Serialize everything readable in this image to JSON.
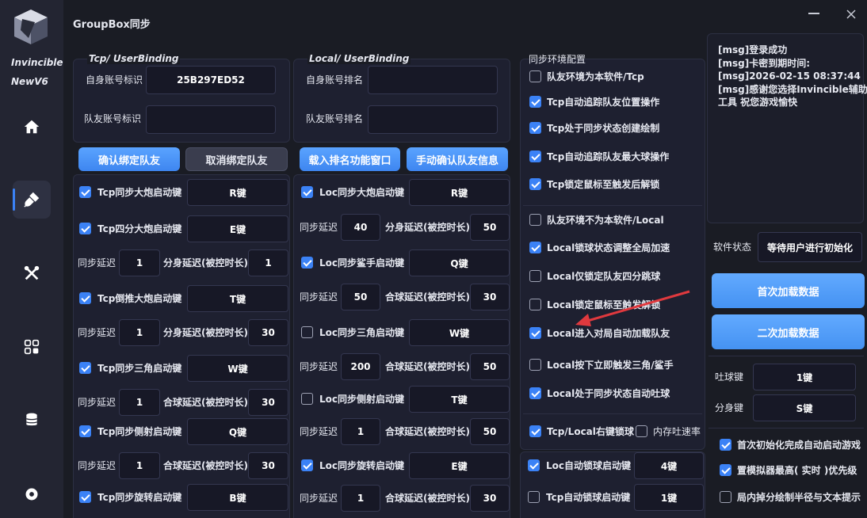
{
  "app": {
    "logo_line1": "Invincible",
    "logo_line2": "NewV6",
    "title": "GroupBox同步"
  },
  "colors": {
    "accent": "#3b82f6",
    "bg": "#1a1c24",
    "sidebar": "#232532",
    "panel": "#1e2030",
    "field": "#171826"
  },
  "sidebar": {
    "icons": [
      "home-icon",
      "plug-icon",
      "tools-icon",
      "apps-icon",
      "database-icon",
      "settings-icon"
    ],
    "active": "plug-icon"
  },
  "tcp": {
    "group_title": "Tcp/ UserBinding",
    "self_label": "自身账号标识",
    "self_value": "25B297ED52",
    "mate_label": "队友账号标识",
    "mate_value": "",
    "bind_btn": "确认绑定队友",
    "unbind_btn": "取消绑定队友",
    "keys": [
      {
        "label": "Tcp同步大炮启动键",
        "checked": true,
        "key": "R键"
      },
      {
        "label": "Tcp四分大炮启动键",
        "checked": true,
        "key": "E键"
      },
      {
        "label": "Tcp倒推大炮启动键",
        "checked": true,
        "key": "T键"
      },
      {
        "label": "Tcp同步三角启动键",
        "checked": true,
        "key": "W键"
      },
      {
        "label": "Tcp同步侧射启动键",
        "checked": true,
        "key": "Q键"
      },
      {
        "label": "Tcp同步旋转启动键",
        "checked": true,
        "key": "B键"
      }
    ],
    "delays": [
      {
        "l1": "同步延迟",
        "v1": "1",
        "l2": "分身延迟(被控时长)",
        "v2": "1"
      },
      {
        "l1": "同步延迟",
        "v1": "1",
        "l2": "分身延迟(被控时长)",
        "v2": "30"
      },
      {
        "l1": "同步延迟",
        "v1": "1",
        "l2": "合球延迟(被控时长)",
        "v2": "30"
      },
      {
        "l1": "同步延迟",
        "v1": "1",
        "l2": "合球延迟(被控时长)",
        "v2": "30"
      }
    ]
  },
  "local": {
    "group_title": "Local/ UserBinding",
    "self_label": "自身账号排名",
    "self_value": "",
    "mate_label": "队友账号排名",
    "mate_value": "",
    "load_btn": "载入排名功能窗口",
    "confirm_btn": "手动确认队友信息",
    "keys": [
      {
        "label": "Loc同步大炮启动键",
        "checked": true,
        "key": "R键"
      },
      {
        "label": "Loc同步鲨手启动键",
        "checked": true,
        "key": "Q键"
      },
      {
        "label": "Loc同步三角启动键",
        "checked": false,
        "key": "W键"
      },
      {
        "label": "Loc同步侧射启动键",
        "checked": false,
        "key": "T键"
      },
      {
        "label": "Loc同步旋转启动键",
        "checked": true,
        "key": "E键"
      }
    ],
    "delays": [
      {
        "l1": "同步延迟",
        "v1": "40",
        "l2": "分身延迟(被控时长)",
        "v2": "50"
      },
      {
        "l1": "同步延迟",
        "v1": "50",
        "l2": "合球延迟(被控时长)",
        "v2": "30"
      },
      {
        "l1": "同步延迟",
        "v1": "200",
        "l2": "合球延迟(被控时长)",
        "v2": "50"
      },
      {
        "l1": "同步延迟",
        "v1": "1",
        "l2": "合球延迟(被控时长)",
        "v2": "50"
      },
      {
        "l1": "同步延迟",
        "v1": "1",
        "l2": "合球延迟(被控时长)",
        "v2": "30"
      }
    ]
  },
  "sync": {
    "title": "同步环境配置",
    "options": [
      {
        "label": "队友环境为本软件/Tcp",
        "checked": false
      },
      {
        "label": "Tcp自动追踪队友位置操作",
        "checked": true
      },
      {
        "label": "Tcp处于同步状态创建绘制",
        "checked": true
      },
      {
        "label": "Tcp自动追踪队友最大球操作",
        "checked": true
      },
      {
        "label": "Tcp锁定鼠标至触发后解锁",
        "checked": true
      },
      {
        "label": "队友环境不为本软件/Local",
        "checked": false
      },
      {
        "label": "Local锁球状态调整全局加速",
        "checked": true
      },
      {
        "label": "Local仅锁定队友四分跳球",
        "checked": false
      },
      {
        "label": "Local锁定鼠标至触发解锁",
        "checked": false
      },
      {
        "label": "Local进入对局自动加载队友",
        "checked": true
      },
      {
        "label": "Local按下立即触发三角/鲨手",
        "checked": false
      },
      {
        "label": "Local处于同步状态自动吐球",
        "checked": true
      }
    ],
    "rightlock": {
      "label": "Tcp/Local右键锁球",
      "checked": true
    },
    "memspeed": {
      "label": "内存吐速率",
      "checked": false
    },
    "auto_keys": [
      {
        "label": "Loc自动锁球启动键",
        "checked": true,
        "key": "4键"
      },
      {
        "label": "Tcp自动锁球启动键",
        "checked": false,
        "key": "1键"
      }
    ]
  },
  "log": {
    "lines": [
      "[msg]登录成功",
      "[msg]卡密到期时间:",
      "[msg]2026-02-15 08:37:44",
      "[msg]感谢您选择Invincible辅助",
      "工具 祝您游戏愉快"
    ]
  },
  "status": {
    "label": "软件状态",
    "value": "等待用户进行初始化"
  },
  "load": {
    "first": "首次加载数据",
    "second": "二次加载数据"
  },
  "keys_right": [
    {
      "label": "吐球键",
      "value": "1键"
    },
    {
      "label": "分身键",
      "value": "S键"
    }
  ],
  "bottom_options": [
    {
      "label": "首次初始化完成自动启动游戏",
      "checked": true
    },
    {
      "label": "置模拟器最高( 实时 )优先级",
      "checked": true
    },
    {
      "label": "局内掉分绘制半径与文本提示",
      "checked": false
    }
  ]
}
